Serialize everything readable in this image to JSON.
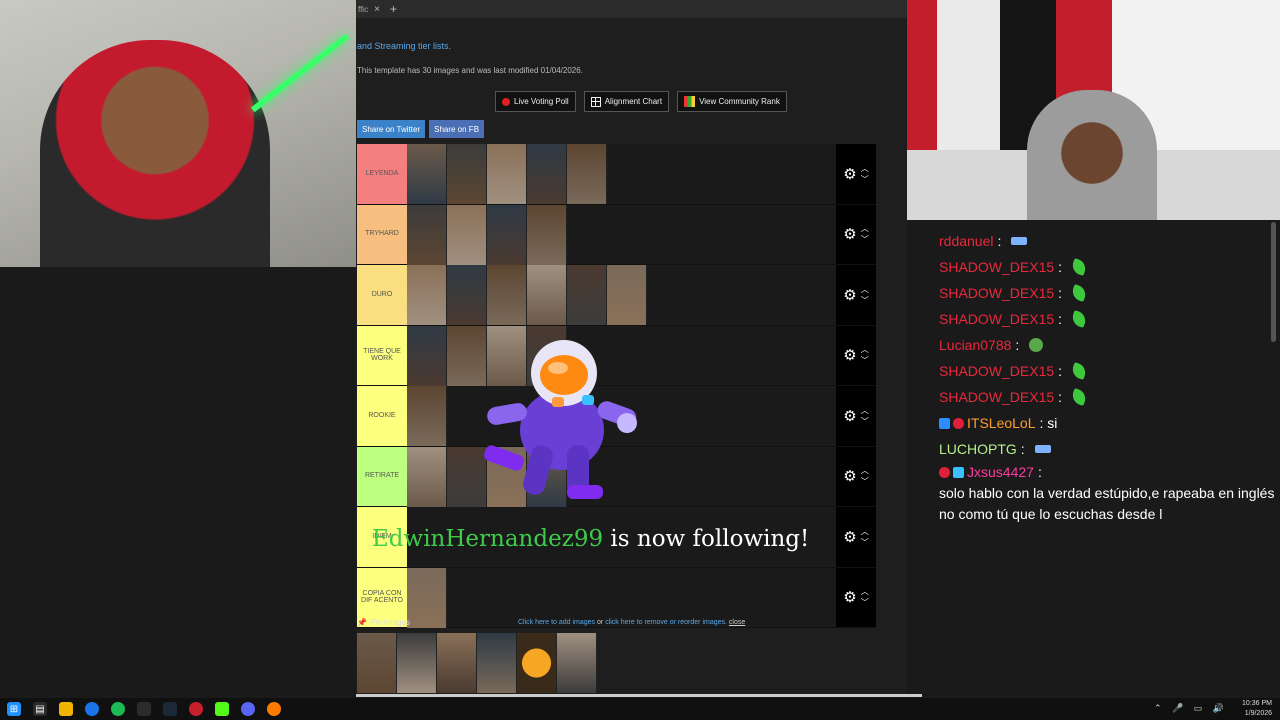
{
  "browser": {
    "tab_title": "ffic",
    "tab_close": "×",
    "tab_new": "+",
    "link_line": "and Streaming tier lists.",
    "info_line": "This template has 30 images and was last modified 01/04/2026.",
    "buttons": {
      "live_voting": "Live Voting Poll",
      "alignment_chart": "Alignment Chart",
      "community_rank": "View Community Rank"
    },
    "share": {
      "twitter": "Share on Twitter",
      "fb": "Share on FB"
    }
  },
  "tiers": [
    {
      "label": "LEYENDA",
      "color": "#f47f7f",
      "count": 5
    },
    {
      "label": "TRYHARD",
      "color": "#f7bf7f",
      "count": 4
    },
    {
      "label": "DURO",
      "color": "#f9df7f",
      "count": 6
    },
    {
      "label": "TIENE QUE WORK",
      "color": "#fdff7f",
      "count": 4
    },
    {
      "label": "ROOKIE",
      "color": "#fdff7f",
      "count": 1
    },
    {
      "label": "RETIRATE",
      "color": "#bdff7f",
      "count": 4
    },
    {
      "label": "IDIEM",
      "color": "#fdff7f",
      "count": 0
    },
    {
      "label": "COPIA CON DIF ACENTO",
      "color": "#fdff7f",
      "count": 1
    }
  ],
  "tier_controls": {
    "gear": "⚙",
    "up": "︿",
    "down": "﹀"
  },
  "pin": {
    "label": "Pin Images",
    "help_prefix": "Click here to add images",
    "help_or": "or",
    "help_link": "click here to remove or reorder images.",
    "close": "close",
    "pool_count": 6
  },
  "alert": {
    "username": "EdwinHernandez99",
    "message": "is now following!"
  },
  "chat": [
    {
      "user": "rddanuel",
      "color": "red",
      "text": "",
      "emote": "fax"
    },
    {
      "user": "SHADOW_DEX15",
      "color": "red",
      "text": "",
      "emote": "leaf"
    },
    {
      "user": "SHADOW_DEX15",
      "color": "red",
      "text": "",
      "emote": "leaf"
    },
    {
      "user": "SHADOW_DEX15",
      "color": "red",
      "text": "",
      "emote": "leaf"
    },
    {
      "user": "Lucian0788",
      "color": "red",
      "text": "",
      "emote": "pepe"
    },
    {
      "user": "SHADOW_DEX15",
      "color": "red",
      "text": "",
      "emote": "leaf"
    },
    {
      "user": "SHADOW_DEX15",
      "color": "red",
      "text": "",
      "emote": "leaf"
    },
    {
      "user": "ITSLeoLoL",
      "color": "orange",
      "text": "si",
      "emote": ""
    },
    {
      "user": "LUCHOPTG",
      "color": "green",
      "text": "",
      "emote": "fax"
    },
    {
      "user": "Jxsus4427",
      "color": "pink",
      "text": "solo hablo con la verdad estúpido,e rapeaba en inglés no como tú que lo escuchas desde l",
      "emote": ""
    }
  ],
  "taskbar": {
    "time": "10:36 PM",
    "date": "1/9/2026"
  },
  "colors": {
    "accent_blue": "#3b82c8",
    "alert_green": "#3ecb4a"
  }
}
